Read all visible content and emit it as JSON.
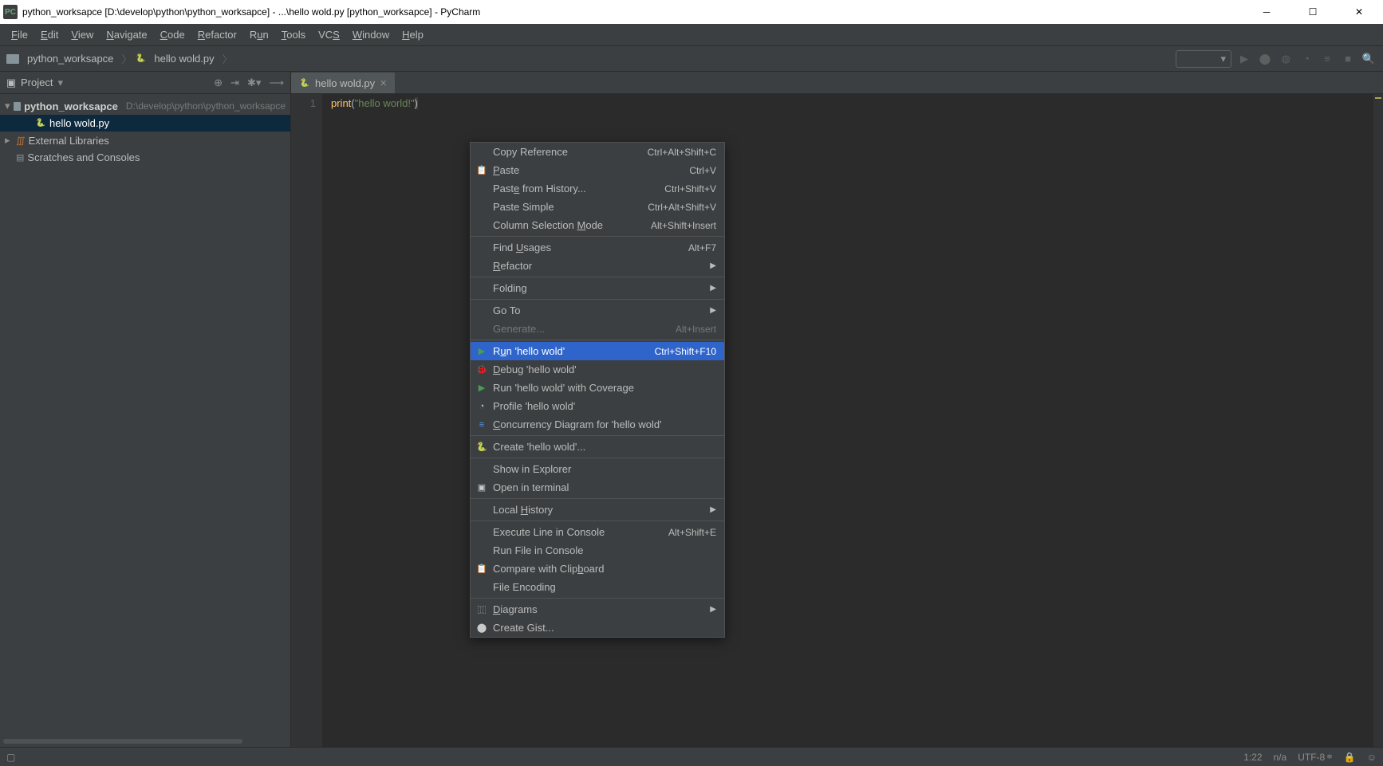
{
  "titlebar": {
    "text": "python_worksapce [D:\\develop\\python\\python_worksapce] - ...\\hello wold.py [python_worksapce] - PyCharm"
  },
  "menubar": {
    "items": [
      "File",
      "Edit",
      "View",
      "Navigate",
      "Code",
      "Refactor",
      "Run",
      "Tools",
      "VCS",
      "Window",
      "Help"
    ]
  },
  "breadcrumb": {
    "root": "python_worksapce",
    "file": "hello wold.py"
  },
  "project": {
    "title": "Project",
    "root_name": "python_worksapce",
    "root_path": "D:\\develop\\python\\python_worksapce",
    "file": "hello wold.py",
    "external_libs": "External Libraries",
    "scratches": "Scratches and Consoles"
  },
  "editor": {
    "tab_name": "hello wold.py",
    "line_number": "1",
    "code_fn": "print",
    "code_str": "\"hello world!\""
  },
  "context_menu": {
    "items": [
      {
        "type": "item",
        "label": "Copy Reference",
        "shortcut": "Ctrl+Alt+Shift+C",
        "icon": ""
      },
      {
        "type": "item",
        "label": "Paste",
        "shortcut": "Ctrl+V",
        "icon": "paste",
        "u": 0
      },
      {
        "type": "item",
        "label": "Paste from History...",
        "shortcut": "Ctrl+Shift+V",
        "icon": "",
        "u": 4
      },
      {
        "type": "item",
        "label": "Paste Simple",
        "shortcut": "Ctrl+Alt+Shift+V",
        "icon": ""
      },
      {
        "type": "item",
        "label": "Column Selection Mode",
        "shortcut": "Alt+Shift+Insert",
        "icon": "",
        "u": 17
      },
      {
        "type": "sep"
      },
      {
        "type": "item",
        "label": "Find Usages",
        "shortcut": "Alt+F7",
        "icon": "",
        "u": 5
      },
      {
        "type": "submenu",
        "label": "Refactor",
        "icon": "",
        "u": 0
      },
      {
        "type": "sep"
      },
      {
        "type": "submenu",
        "label": "Folding",
        "icon": ""
      },
      {
        "type": "sep"
      },
      {
        "type": "submenu",
        "label": "Go To",
        "icon": ""
      },
      {
        "type": "item",
        "label": "Generate...",
        "shortcut": "Alt+Insert",
        "icon": "",
        "disabled": true
      },
      {
        "type": "sep"
      },
      {
        "type": "item",
        "label": "Run 'hello wold'",
        "shortcut": "Ctrl+Shift+F10",
        "icon": "green-play",
        "highlight": true,
        "u": 1
      },
      {
        "type": "item",
        "label": "Debug 'hello wold'",
        "icon": "bug",
        "u": 0
      },
      {
        "type": "item",
        "label": "Run 'hello wold' with Coverage",
        "icon": "cov"
      },
      {
        "type": "item",
        "label": "Profile 'hello wold'",
        "icon": "profile"
      },
      {
        "type": "item",
        "label": "Concurrency Diagram for 'hello wold'",
        "icon": "conc",
        "u": 0
      },
      {
        "type": "sep"
      },
      {
        "type": "item",
        "label": "Create 'hello wold'...",
        "icon": "py"
      },
      {
        "type": "sep"
      },
      {
        "type": "item",
        "label": "Show in Explorer",
        "icon": ""
      },
      {
        "type": "item",
        "label": "Open in terminal",
        "icon": "terminal"
      },
      {
        "type": "sep"
      },
      {
        "type": "submenu",
        "label": "Local History",
        "icon": "",
        "u": 6
      },
      {
        "type": "sep"
      },
      {
        "type": "item",
        "label": "Execute Line in Console",
        "shortcut": "Alt+Shift+E",
        "icon": ""
      },
      {
        "type": "item",
        "label": "Run File in Console",
        "icon": ""
      },
      {
        "type": "item",
        "label": "Compare with Clipboard",
        "icon": "paste",
        "u": 17
      },
      {
        "type": "item",
        "label": "File Encoding",
        "icon": ""
      },
      {
        "type": "sep"
      },
      {
        "type": "submenu",
        "label": "Diagrams",
        "icon": "diagrams",
        "u": 0
      },
      {
        "type": "item",
        "label": "Create Gist...",
        "icon": "gist"
      }
    ]
  },
  "statusbar": {
    "pos": "1:22",
    "na": "n/a",
    "encoding": "UTF-8"
  }
}
